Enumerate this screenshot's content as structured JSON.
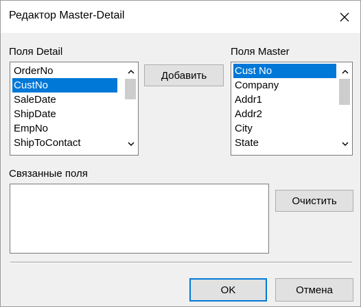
{
  "window": {
    "title": "Редактор Master-Detail"
  },
  "detail": {
    "label": "Поля Detail",
    "items": [
      "OrderNo",
      "CustNo",
      "SaleDate",
      "ShipDate",
      "EmpNo",
      "ShipToContact"
    ],
    "selected_index": 1
  },
  "master": {
    "label": "Поля Master",
    "items": [
      "Cust No",
      "Company",
      "Addr1",
      "Addr2",
      "City",
      "State"
    ],
    "selected_index": 0
  },
  "buttons": {
    "add": "Добавить",
    "clear": "Очистить",
    "ok": "OK",
    "cancel": "Отмена"
  },
  "linked": {
    "label": "Связанные поля",
    "items": []
  },
  "icons": {
    "close": "close-icon",
    "scroll_up": "chevron-up-icon",
    "scroll_down": "chevron-down-icon"
  },
  "colors": {
    "selection": "#0078d7",
    "default_button_border": "#0078d7"
  }
}
